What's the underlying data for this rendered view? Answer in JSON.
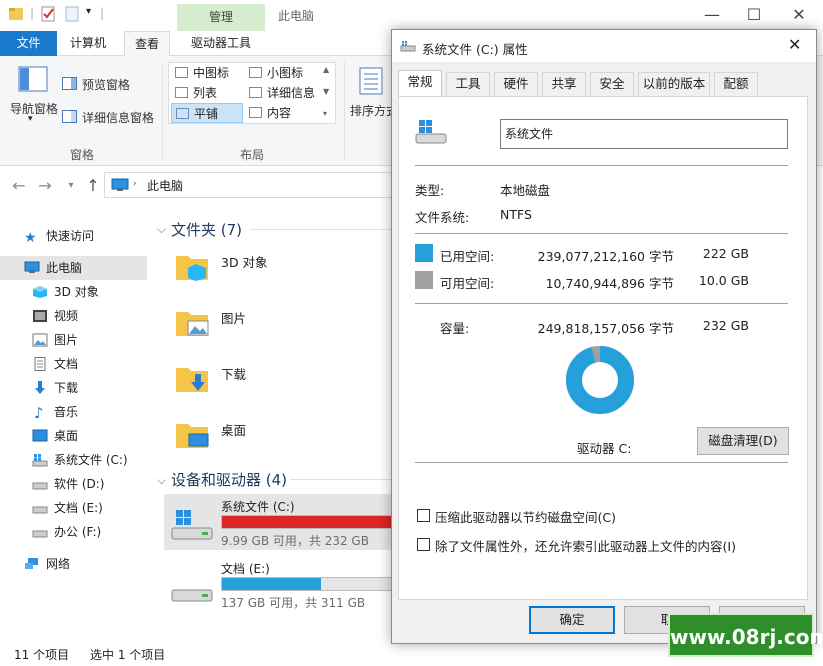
{
  "explorer": {
    "title": "此电脑",
    "context_tab": "管理",
    "tabs": [
      "文件",
      "计算机",
      "查看",
      "驱动器工具"
    ],
    "ribbon": {
      "nav_pane": "导航窗格",
      "preview_pane": "预览窗格",
      "details_pane": "详细信息窗格",
      "pane_group": "窗格",
      "layout_items": [
        "中图标",
        "小图标",
        "列表",
        "详细信息",
        "平铺",
        "内容"
      ],
      "layout_group": "布局",
      "sort": "排序方式"
    },
    "address": "此电脑",
    "nav": {
      "quick_access": "快速访问",
      "this_pc": "此电脑",
      "items": [
        "3D 对象",
        "视频",
        "图片",
        "文档",
        "下载",
        "音乐",
        "桌面",
        "系统文件 (C:)",
        "软件 (D:)",
        "文档 (E:)",
        "办公 (F:)"
      ],
      "network": "网络"
    },
    "folders_header": "文件夹 (7)",
    "folders": [
      "3D 对象",
      "图片",
      "下载",
      "桌面"
    ],
    "drives_header": "设备和驱动器 (4)",
    "drives": [
      {
        "name": "系统文件 (C:)",
        "info": "9.99 GB 可用，共 232 GB",
        "used_fraction": 0.957,
        "color": "#da2626"
      },
      {
        "name": "文档 (E:)",
        "info": "137 GB 可用，共 311 GB",
        "used_fraction": 0.559,
        "color": "#26a0da"
      }
    ],
    "status": {
      "count": "11 个项目",
      "selected": "选中 1 个项目"
    }
  },
  "dialog": {
    "title": "系统文件 (C:) 属性",
    "tabs": [
      "常规",
      "工具",
      "硬件",
      "共享",
      "安全",
      "以前的版本",
      "配额"
    ],
    "name_value": "系统文件",
    "type_label": "类型:",
    "type_value": "本地磁盘",
    "fs_label": "文件系统:",
    "fs_value": "NTFS",
    "used_label": "已用空间:",
    "used_bytes": "239,077,212,160 字节",
    "used_gb": "222 GB",
    "free_label": "可用空间:",
    "free_bytes": "10,740,944,896 字节",
    "free_gb": "10.0 GB",
    "cap_label": "容量:",
    "cap_bytes": "249,818,157,056 字节",
    "cap_gb": "232 GB",
    "drive_label": "驱动器 C:",
    "cleanup_button": "磁盘清理(D)",
    "compress_label": "压缩此驱动器以节约磁盘空间(C)",
    "index_label": "除了文件属性外，还允许索引此驱动器上文件的内容(I)",
    "ok_button": "确定",
    "cancel_button": "取",
    "used_color": "#26a0da",
    "free_color": "#a0a0a0",
    "used_fraction": 0.957
  },
  "watermark": "www.08rj.com"
}
